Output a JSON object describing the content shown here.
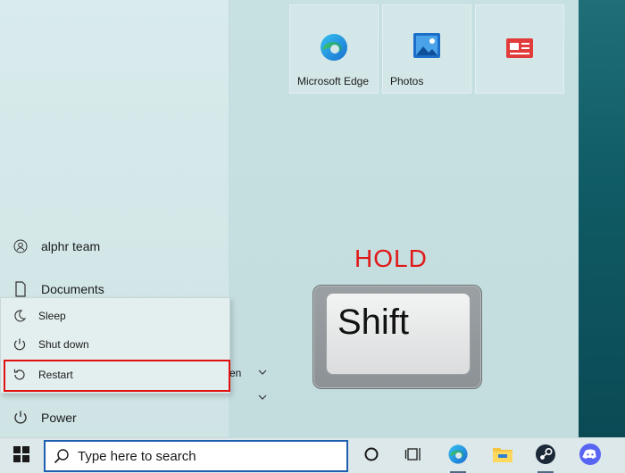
{
  "start_menu": {
    "tiles": [
      {
        "label": "Microsoft Edge",
        "icon": "edge-icon"
      },
      {
        "label": "Photos",
        "icon": "photos-icon"
      },
      {
        "label": "",
        "icon": "news-icon"
      }
    ],
    "left_items": [
      {
        "label": "alphr team",
        "icon": "user-icon"
      },
      {
        "label": "Documents",
        "icon": "document-icon"
      },
      {
        "label": "Power",
        "icon": "power-icon"
      }
    ],
    "power_menu": [
      {
        "label": "Sleep",
        "icon": "moon-icon"
      },
      {
        "label": "Shut down",
        "icon": "power-icon"
      },
      {
        "label": "Restart",
        "icon": "restart-icon"
      }
    ],
    "list_fragment": "en"
  },
  "overlay": {
    "hold_text": "HOLD",
    "key_label": "Shift"
  },
  "taskbar": {
    "search_placeholder": "Type here to search",
    "icons": [
      "windows-icon",
      "search-icon",
      "cortana-icon",
      "task-view-icon",
      "edge-icon",
      "file-explorer-icon",
      "steam-icon",
      "discord-icon"
    ]
  },
  "colors": {
    "highlight": "#e01010",
    "hold": "#e01818",
    "accent": "#1f5fb0"
  }
}
